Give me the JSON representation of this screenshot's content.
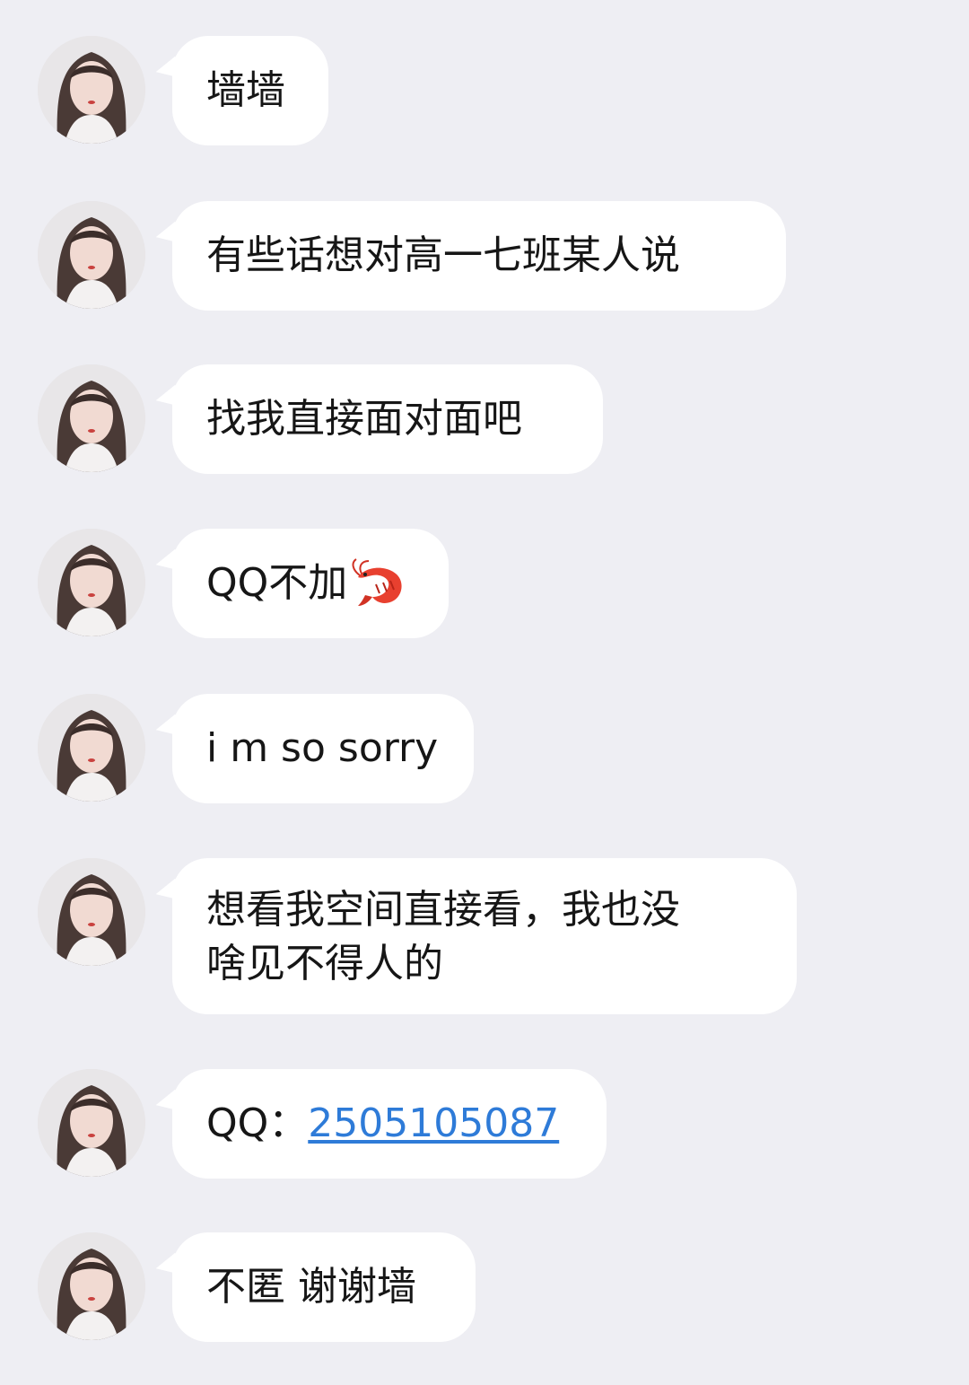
{
  "messages": [
    {
      "text": "墙墙"
    },
    {
      "text": "有些话想对高一七班某人说"
    },
    {
      "text": "找我直接面对面吧"
    },
    {
      "text": "QQ不加",
      "emoji": "shrimp-emoji"
    },
    {
      "text": "i m so sorry"
    },
    {
      "lines": [
        "想看我空间直接看，我也没",
        "啥见不得人的"
      ]
    },
    {
      "prefix": "QQ：",
      "link": "2505105087"
    },
    {
      "text": "不匿 谢谢墙"
    }
  ],
  "colors": {
    "background": "#eeeef3",
    "bubble": "#ffffff",
    "link": "#2e7bd8"
  }
}
